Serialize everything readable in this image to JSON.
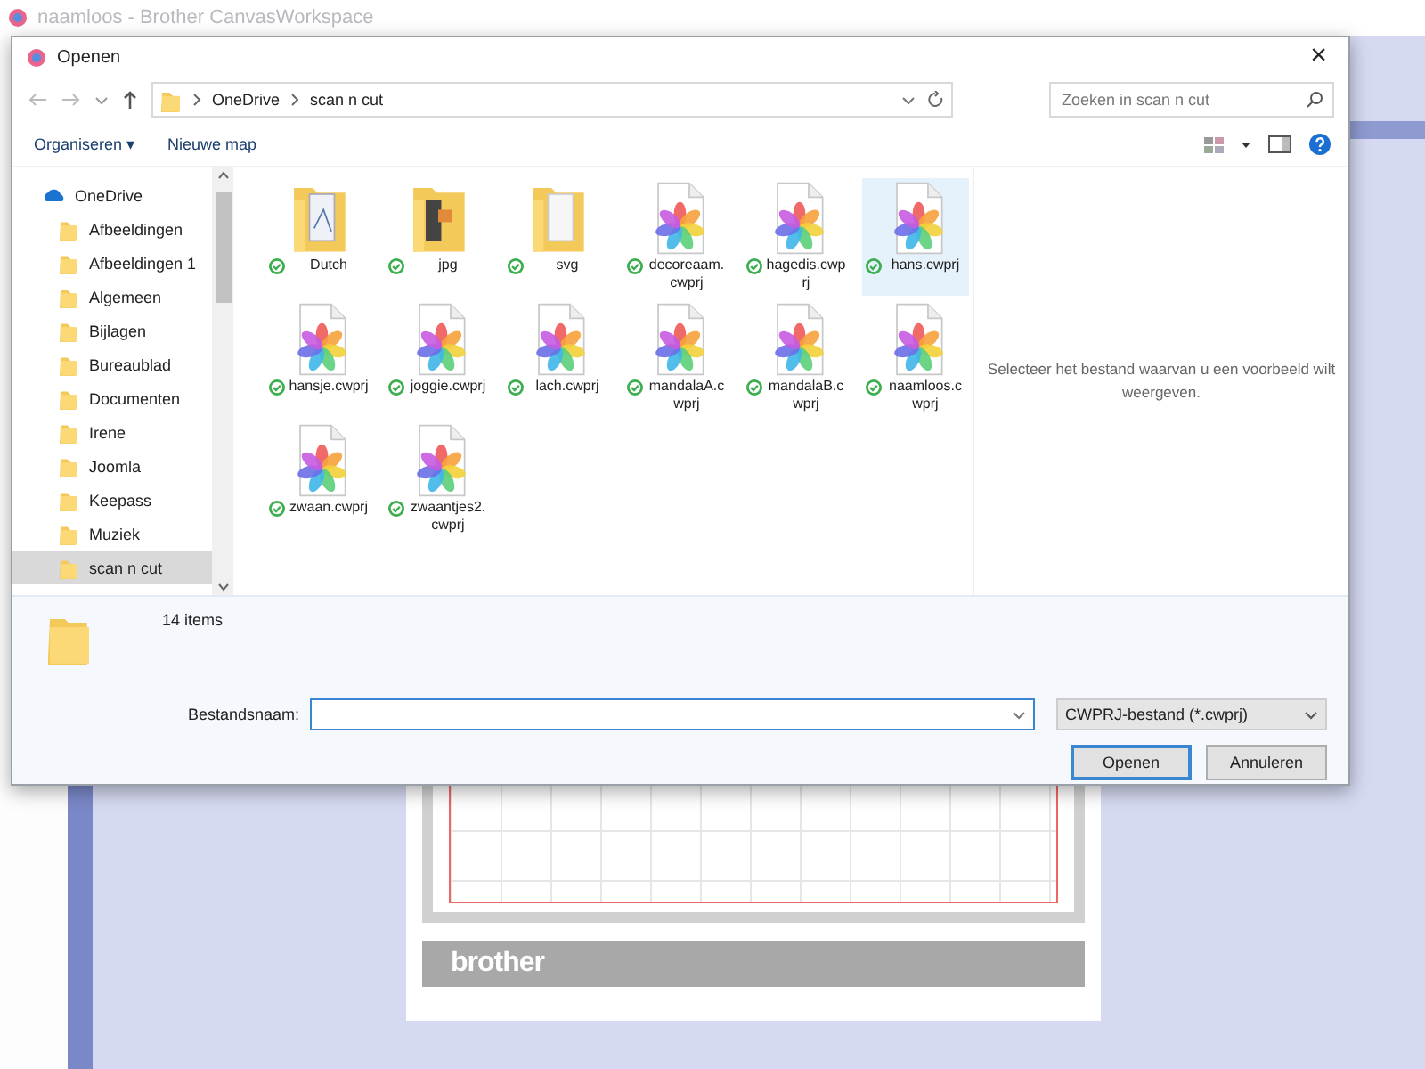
{
  "app": {
    "title": "naamloos - Brother CanvasWorkspace",
    "mat_brand": "brother"
  },
  "dialog": {
    "title": "Openen",
    "close": "×",
    "address": [
      "OneDrive",
      "scan n cut"
    ],
    "search": {
      "placeholder": "Zoeken in scan n cut"
    },
    "toolbar": {
      "organize": "Organiseren ▾",
      "new_folder": "Nieuwe map"
    },
    "sidebar": {
      "items": [
        {
          "label": "OneDrive",
          "kind": "cloud",
          "selected": false
        },
        {
          "label": "Afbeeldingen",
          "kind": "folder",
          "selected": false
        },
        {
          "label": "Afbeeldingen 1",
          "kind": "folder",
          "selected": false
        },
        {
          "label": "Algemeen",
          "kind": "folder",
          "selected": false
        },
        {
          "label": "Bijlagen",
          "kind": "folder",
          "selected": false
        },
        {
          "label": "Bureaublad",
          "kind": "folder",
          "selected": false
        },
        {
          "label": "Documenten",
          "kind": "folder",
          "selected": false
        },
        {
          "label": "Irene",
          "kind": "folder",
          "selected": false
        },
        {
          "label": "Joomla",
          "kind": "folder",
          "selected": false
        },
        {
          "label": "Keepass",
          "kind": "folder",
          "selected": false
        },
        {
          "label": "Muziek",
          "kind": "folder",
          "selected": false
        },
        {
          "label": "scan n cut",
          "kind": "folder",
          "selected": true
        }
      ]
    },
    "files": [
      {
        "name": "Dutch",
        "kind": "folder",
        "selected": false
      },
      {
        "name": "jpg",
        "kind": "folder",
        "selected": false
      },
      {
        "name": "svg",
        "kind": "folder",
        "selected": false
      },
      {
        "name": "decoreaam.cwprj",
        "kind": "file",
        "selected": false
      },
      {
        "name": "hagedis.cwprj",
        "kind": "file",
        "selected": false
      },
      {
        "name": "hans.cwprj",
        "kind": "file",
        "selected": true
      },
      {
        "name": "hansje.cwprj",
        "kind": "file",
        "selected": false
      },
      {
        "name": "joggie.cwprj",
        "kind": "file",
        "selected": false
      },
      {
        "name": "lach.cwprj",
        "kind": "file",
        "selected": false
      },
      {
        "name": "mandalaA.cwprj",
        "kind": "file",
        "selected": false
      },
      {
        "name": "mandalaB.cwprj",
        "kind": "file",
        "selected": false
      },
      {
        "name": "naamloos.cwprj",
        "kind": "file",
        "selected": false
      },
      {
        "name": "zwaan.cwprj",
        "kind": "file",
        "selected": false
      },
      {
        "name": "zwaantjes2.cwprj",
        "kind": "file",
        "selected": false
      }
    ],
    "preview_hint": "Selecteer het bestand waarvan u een voorbeeld wilt weergeven.",
    "details": {
      "count": "14 items"
    },
    "filename": {
      "label": "Bestandsnaam:"
    },
    "filter": "CWPRJ-bestand (*.cwprj)",
    "buttons": [
      "Openen",
      "Annuleren"
    ]
  }
}
